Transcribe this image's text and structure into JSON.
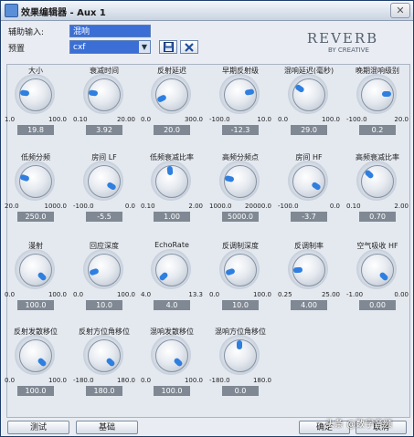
{
  "window": {
    "title": "效果编辑器 - Aux 1",
    "close_label": "✕"
  },
  "header": {
    "aux_input_label": "辅助输入:",
    "aux_input_value": "混响",
    "preset_label": "预置",
    "preset_value": "cxf",
    "preset_arrow": "▼",
    "save_icon": "floppy-disk-icon",
    "delete_icon": "x-icon"
  },
  "logo": {
    "main": "REVERB",
    "sub": "BY CREATIVE"
  },
  "controls": [
    {
      "label": "大小",
      "min": "1.0",
      "max": "100.0",
      "value": "19.8",
      "level": 0.19
    },
    {
      "label": "衰减时间",
      "min": "0.10",
      "max": "20.00",
      "value": "3.92",
      "level": 0.19
    },
    {
      "label": "反射延迟",
      "min": "0.0",
      "max": "300.0",
      "value": "20.0",
      "level": 0.07
    },
    {
      "label": "早期反射级",
      "min": "-100.0",
      "max": "10.0",
      "value": "-12.3",
      "level": 0.8
    },
    {
      "label": "混响延迟(毫秒)",
      "min": "0.0",
      "max": "100.0",
      "value": "29.0",
      "level": 0.29
    },
    {
      "label": "晚期混响级别",
      "min": "-100.0",
      "max": "20.0",
      "value": "0.2",
      "level": 0.83
    },
    {
      "label": "低频分频",
      "min": "20.0",
      "max": "1000.0",
      "value": "250.0",
      "level": 0.23
    },
    {
      "label": "房间 LF",
      "min": "-100.0",
      "max": "0.0",
      "value": "-5.5",
      "level": 0.95
    },
    {
      "label": "低频衰减比率",
      "min": "0.10",
      "max": "2.00",
      "value": "1.00",
      "level": 0.48
    },
    {
      "label": "高频分频点",
      "min": "1000.0",
      "max": "20000.0",
      "value": "5000.0",
      "level": 0.21
    },
    {
      "label": "房间 HF",
      "min": "-100.0",
      "max": "0.0",
      "value": "-3.7",
      "level": 0.96
    },
    {
      "label": "高频衰减比率",
      "min": "0.10",
      "max": "2.00",
      "value": "0.70",
      "level": 0.32
    },
    {
      "label": "漫射",
      "min": "0.0",
      "max": "100.0",
      "value": "100.0",
      "level": 1.0
    },
    {
      "label": "回应深度",
      "min": "0.0",
      "max": "100.0",
      "value": "10.0",
      "level": 0.1
    },
    {
      "label": "EchoRate",
      "min": "4.0",
      "max": "13.3",
      "value": "4.0",
      "level": 0.0
    },
    {
      "label": "反调制深度",
      "min": "0.0",
      "max": "100.0",
      "value": "10.0",
      "level": 0.1
    },
    {
      "label": "反调制率",
      "min": "0.25",
      "max": "25.00",
      "value": "4.00",
      "level": 0.15
    },
    {
      "label": "空气吸收 HF",
      "min": "-1.00",
      "max": "0.00",
      "value": "0.00",
      "level": 1.0
    },
    {
      "label": "反射发散移位",
      "min": "0.0",
      "max": "100.0",
      "value": "100.0",
      "level": 1.0
    },
    {
      "label": "反射方位角移位",
      "min": "-180.0",
      "max": "180.0",
      "value": "180.0",
      "level": 1.0
    },
    {
      "label": "混响发散移位",
      "min": "0.0",
      "max": "100.0",
      "value": "100.0",
      "level": 1.0
    },
    {
      "label": "混响方位角移位",
      "min": "-180.0",
      "max": "180.0",
      "value": "0.0",
      "level": 0.5
    }
  ],
  "buttons": {
    "test": "测试",
    "basic": "基础",
    "ok": "确定",
    "cancel": "取消"
  },
  "watermark": "头条 @数字音频"
}
